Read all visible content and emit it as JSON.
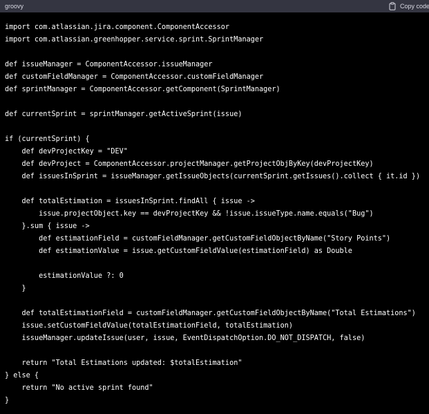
{
  "header": {
    "language": "groovy",
    "copy_label": "Copy code",
    "copy_icon": "clipboard-icon"
  },
  "code": {
    "lines": [
      "import com.atlassian.jira.component.ComponentAccessor",
      "import com.atlassian.greenhopper.service.sprint.SprintManager",
      "",
      "def issueManager = ComponentAccessor.issueManager",
      "def customFieldManager = ComponentAccessor.customFieldManager",
      "def sprintManager = ComponentAccessor.getComponent(SprintManager)",
      "",
      "def currentSprint = sprintManager.getActiveSprint(issue)",
      "",
      "if (currentSprint) {",
      "    def devProjectKey = \"DEV\"",
      "    def devProject = ComponentAccessor.projectManager.getProjectObjByKey(devProjectKey)",
      "    def issuesInSprint = issueManager.getIssueObjects(currentSprint.getIssues().collect { it.id })",
      "",
      "    def totalEstimation = issuesInSprint.findAll { issue ->",
      "        issue.projectObject.key == devProjectKey && !issue.issueType.name.equals(\"Bug\")",
      "    }.sum { issue ->",
      "        def estimationField = customFieldManager.getCustomFieldObjectByName(\"Story Points\")",
      "        def estimationValue = issue.getCustomFieldValue(estimationField) as Double",
      "",
      "        estimationValue ?: 0",
      "    }",
      "",
      "    def totalEstimationField = customFieldManager.getCustomFieldObjectByName(\"Total Estimations\")",
      "    issue.setCustomFieldValue(totalEstimationField, totalEstimation)",
      "    issueManager.updateIssue(user, issue, EventDispatchOption.DO_NOT_DISPATCH, false)",
      "",
      "    return \"Total Estimations updated: $totalEstimation\"",
      "} else {",
      "    return \"No active sprint found\"",
      "}"
    ]
  },
  "colors": {
    "header_bg": "#343541",
    "code_bg": "#000000",
    "text": "#ffffff",
    "header_text": "#d9d9e3"
  }
}
